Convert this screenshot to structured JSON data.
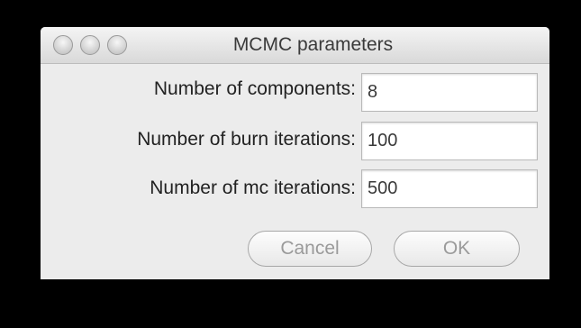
{
  "window": {
    "title": "MCMC parameters"
  },
  "fields": [
    {
      "label": "Number of components:",
      "value": "8"
    },
    {
      "label": "Number of burn iterations:",
      "value": "100"
    },
    {
      "label": "Number of mc iterations:",
      "value": "500"
    }
  ],
  "buttons": {
    "cancel_label": "Cancel",
    "ok_label": "OK"
  },
  "colors": {
    "background": "#000000",
    "dialog": "#ececec",
    "button_text": "#9a9a9a"
  },
  "icons": [
    "close-icon",
    "minimize-icon",
    "zoom-icon"
  ]
}
